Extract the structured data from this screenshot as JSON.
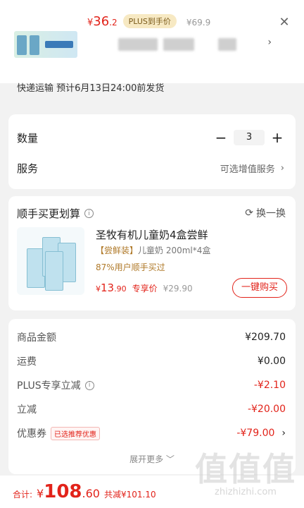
{
  "header": {
    "price_currency": "¥",
    "price_int": "36",
    "price_dec": ".2",
    "plus_tag": "PLUS到手价",
    "orig_price": "¥69.9",
    "close_icon": "close-icon",
    "shipping_note": "快递运输 预计6月13日24:00前发货"
  },
  "order": {
    "quantity_label": "数量",
    "quantity_value": "3",
    "minus": "−",
    "plus": "+",
    "service_label": "服务",
    "service_value": "可选增值服务"
  },
  "addon": {
    "title": "顺手买更划算",
    "refresh": "换一换",
    "product_name": "圣牧有机儿童奶4盒尝鲜",
    "product_tag": "【尝鲜装】",
    "product_spec": "儿童奶 200ml*4盒",
    "buyers": "87%用户顺手买过",
    "price_cur": "¥",
    "price_int": "13",
    "price_dec": ".90",
    "exclusive_label": "专享价",
    "orig_price": "¥29.90",
    "buy_button": "一键购买"
  },
  "fees": {
    "rows": [
      {
        "label": "商品金额",
        "value": "¥209.70"
      },
      {
        "label": "运费",
        "value": "¥0.00"
      },
      {
        "label": "PLUS专享立减",
        "value": "-¥2.10"
      },
      {
        "label": "立减",
        "value": "-¥20.00"
      },
      {
        "label": "优惠券",
        "value": "-¥79.00",
        "tag": "已选推荐优惠"
      }
    ],
    "expand": "展开更多"
  },
  "footer": {
    "total_label": "合计:",
    "total_cur": "¥",
    "total_int": "108",
    "total_dec": ".60",
    "saved": "共减¥101.10"
  },
  "watermark": {
    "big": "值值值",
    "site": "zhizhizhi.com"
  },
  "colors": {
    "accent": "#e2231a",
    "plus_bg": "#f7e9c3",
    "gold": "#b07a2a"
  }
}
